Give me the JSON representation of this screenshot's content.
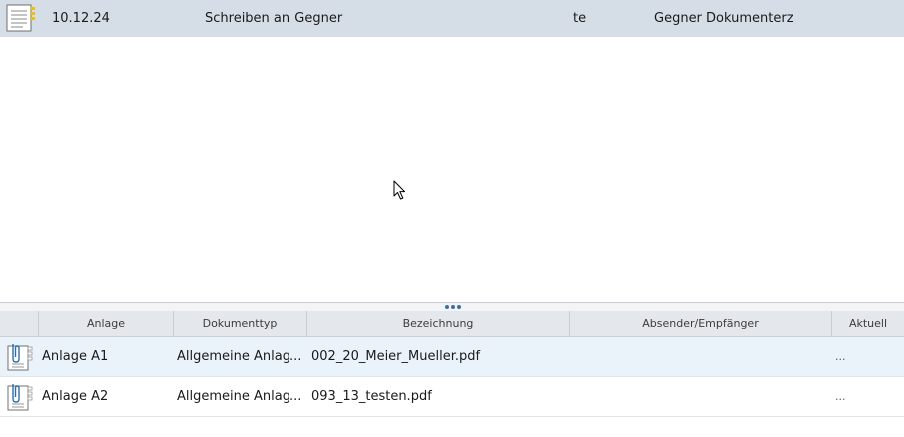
{
  "document_list": {
    "rows": [
      {
        "date": "10.12.24",
        "subject": "Schreiben an Gegner",
        "author": "te",
        "type": "Gegner Dokumenterz",
        "icon": "document-note-icon"
      }
    ]
  },
  "attachments": {
    "columns": [
      "Anlage",
      "Dokumenttyp",
      "Bezeichnung",
      "Absender/Empfänger",
      "Aktuell"
    ],
    "rows": [
      {
        "name": "Anlage A1",
        "doctype": "Allgemeine Anlage (",
        "ellipsis": "...",
        "filename": "002_20_Meier_Mueller.pdf",
        "current": "...",
        "icon": "paperclip-document-icon"
      },
      {
        "name": "Anlage A2",
        "doctype": "Allgemeine Anlage (",
        "ellipsis": "...",
        "filename": "093_13_testen.pdf",
        "current": "...",
        "icon": "paperclip-document-icon"
      }
    ]
  },
  "colors": {
    "selected_row": "#d5dde6",
    "attachment_selected": "#eaf2fa",
    "header_bg": "#e4e7eb",
    "splitter_dots": "#3f6ea0"
  }
}
